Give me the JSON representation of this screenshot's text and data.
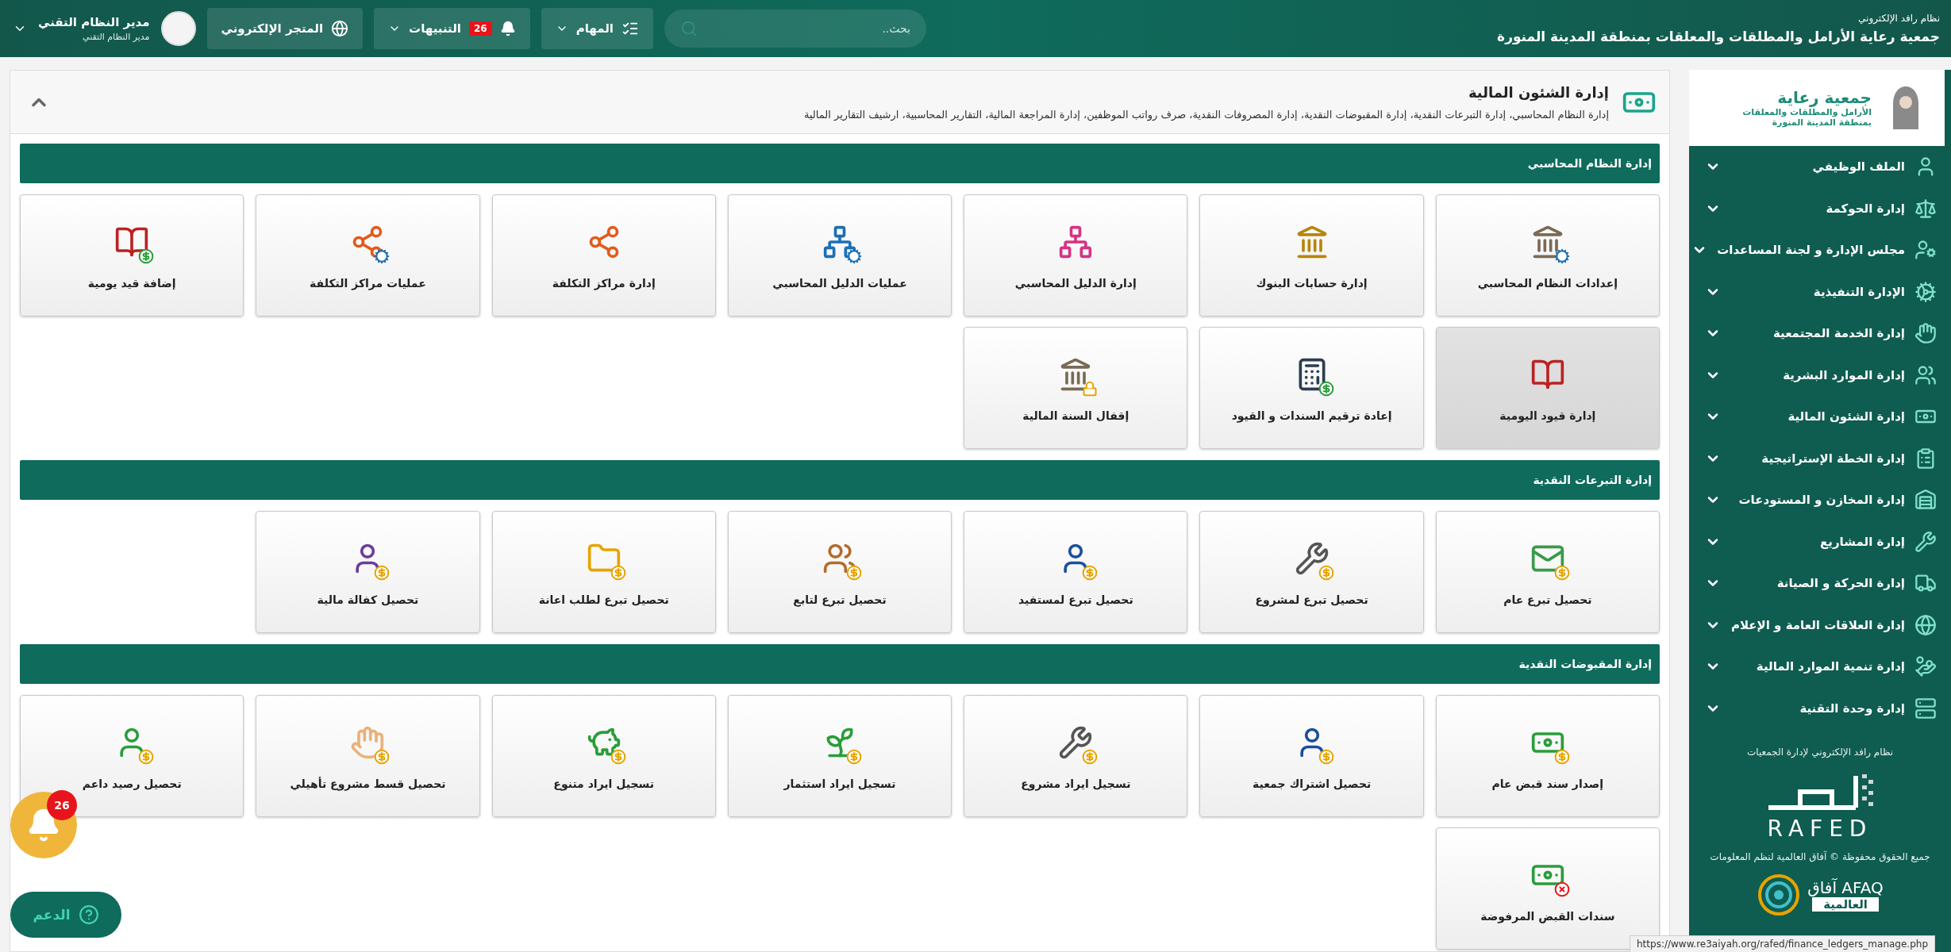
{
  "topbar": {
    "system_name": "نظام رافد الإلكتروني",
    "org_name": "جمعية رعاية الأرامل والمطلقات والمعلقات بمنطقة المدينة المنورة",
    "search": {
      "placeholder": "بحث.."
    },
    "tasks": "المهام",
    "alerts": {
      "label": "التنبيهات",
      "count": "26"
    },
    "store": "المتجر الإلكتروني",
    "user": {
      "name": "مدير النظام التقني",
      "role": "مدير النظام التقني"
    }
  },
  "sidebar": {
    "logo": {
      "title": "جمعية رعاية",
      "line_1": "الأرامل والمطلقات والمعلقات",
      "line_2": "بمنطقة المدينة المنورة"
    },
    "items": [
      {
        "label": "الملف الوظيفي"
      },
      {
        "label": "إدارة الحوكمة"
      },
      {
        "label": "مجلس الإدارة و لجنة المساعدات"
      },
      {
        "label": "الإدارة التنفيذية"
      },
      {
        "label": "إدارة الخدمة المجتمعية"
      },
      {
        "label": "إدارة الموارد البشرية"
      },
      {
        "label": "إدارة الشئون المالية"
      },
      {
        "label": "إدارة الخطة الإستراتيجية"
      },
      {
        "label": "إدارة المخازن و المستودعات"
      },
      {
        "label": "إدارة المشاريع"
      },
      {
        "label": "إدارة الحركة و الصيانة"
      },
      {
        "label": "إدارة العلاقات العامة و الإعلام"
      },
      {
        "label": "إدارة تنمية الموارد المالية"
      },
      {
        "label": "إدارة وحدة التقنية"
      }
    ],
    "footer": {
      "tagline": "نظام رافد الإلكتروني لإدارة الجمعيات",
      "rafed_logo": "RAFED",
      "copyright": "جميع الحقوق محفوظة © آفاق العالمية لنظم المعلومات",
      "afaq_latin": "AFAQ",
      "afaq_arabic": "آفاق",
      "afaq_subtitle": "العالمية"
    }
  },
  "page_header": {
    "title": "إدارة الشئون المالية",
    "description": "إدارة النظام المحاسبي، إدارة التبرعات النقدية، إدارة المقبوضات النقدية، إدارة المصروفات النقدية، صرف رواتب الموظفين، إدارة المراجعة المالية، التقارير المحاسبية، ارشيف التقارير المالية"
  },
  "sections": [
    {
      "title": "إدارة النظام المحاسبي",
      "tiles": [
        {
          "label": "إعدادات النظام المحاسبي",
          "hovered": false
        },
        {
          "label": "إدارة حسابات البنوك",
          "hovered": false
        },
        {
          "label": "إدارة الدليل المحاسبي",
          "hovered": false
        },
        {
          "label": "عمليات الدليل المحاسبي",
          "hovered": false
        },
        {
          "label": "إدارة مراكز التكلفة",
          "hovered": false
        },
        {
          "label": "عمليات مراكز التكلفة",
          "hovered": false
        },
        {
          "label": "إضافة قيد يومية",
          "hovered": false
        },
        {
          "label": "إدارة قيود اليومية",
          "hovered": true
        },
        {
          "label": "إعادة ترقيم السندات و القيود",
          "hovered": false
        },
        {
          "label": "إقفال السنة المالية",
          "hovered": false
        }
      ]
    },
    {
      "title": "إدارة التبرعات النقدية",
      "tiles": [
        {
          "label": "تحصيل تبرع عام",
          "hovered": false
        },
        {
          "label": "تحصيل تبرع لمشروع",
          "hovered": false
        },
        {
          "label": "تحصيل تبرع لمستفيد",
          "hovered": false
        },
        {
          "label": "تحصيل تبرع لتابع",
          "hovered": false
        },
        {
          "label": "تحصيل تبرع لطلب اعانة",
          "hovered": false
        },
        {
          "label": "تحصيل كفالة مالية",
          "hovered": false
        }
      ]
    },
    {
      "title": "إدارة المقبوضات النقدية",
      "tiles": [
        {
          "label": "إصدار سند قبض عام",
          "hovered": false
        },
        {
          "label": "تحصيل اشتراك جمعية",
          "hovered": false
        },
        {
          "label": "تسجيل ايراد مشروع",
          "hovered": false
        },
        {
          "label": "تسجيل ايراد استثمار",
          "hovered": false
        },
        {
          "label": "تسجيل ايراد متنوع",
          "hovered": false
        },
        {
          "label": "تحصيل قسط مشروع تأهيلي",
          "hovered": false
        },
        {
          "label": "تحصيل رصيد داعم",
          "hovered": false
        },
        {
          "label": "سندات القبض المرفوضة",
          "hovered": false
        }
      ]
    }
  ],
  "floating": {
    "notifications_count": "26",
    "support": "الدعم"
  },
  "status_url": "https://www.re3aiyah.org/rafed/finance_ledgers_manage.php"
}
